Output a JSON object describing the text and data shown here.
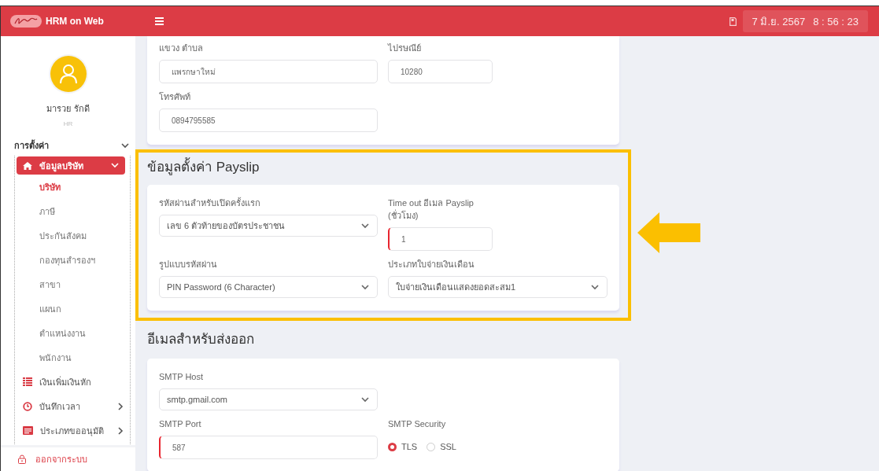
{
  "header": {
    "app_title": "HRM on Web",
    "date": "7 มิ.ย. 2567",
    "time": "8 : 56 : 23"
  },
  "user": {
    "name": "มารวย รักดี",
    "role": "HR"
  },
  "sidebar": {
    "section": "การตั้งค่า",
    "expanded": true,
    "items": [
      {
        "label": "ข้อมูลบริษัท",
        "kind": "group",
        "selected": true,
        "expanded": true,
        "children": [
          {
            "label": "บริษัท",
            "selected": true
          },
          {
            "label": "ภาษี",
            "selected": false
          },
          {
            "label": "ประกันสังคม",
            "selected": false
          },
          {
            "label": "กองทุนสำรองฯ",
            "selected": false
          },
          {
            "label": "สาขา",
            "selected": false
          },
          {
            "label": "แผนก",
            "selected": false
          },
          {
            "label": "ตำแหน่งงาน",
            "selected": false
          },
          {
            "label": "พนักงาน",
            "selected": false
          }
        ]
      },
      {
        "label": "เงินเพิ่มเงินหัก",
        "kind": "link",
        "selected": false
      },
      {
        "label": "บันทึกเวลา",
        "kind": "group",
        "selected": false,
        "expanded": false
      },
      {
        "label": "ประเภทขออนุมัติ",
        "kind": "group",
        "selected": false,
        "expanded": false
      }
    ],
    "logout": "ออกจากระบบ"
  },
  "sections": [
    {
      "highlighted": false,
      "rows": [
        [
          {
            "label": "แขวง ตำบล",
            "kind": "input",
            "value": "แพรกษาใหม่",
            "invalid": false
          },
          {
            "label": "ไปรษณีย์",
            "kind": "input",
            "value": "10280",
            "invalid": false
          }
        ],
        [
          {
            "label": "โทรศัพท์",
            "kind": "input",
            "value": "0894795585",
            "invalid": false
          }
        ]
      ]
    },
    {
      "title": "ข้อมูลตั้งค่า Payslip",
      "highlighted": true,
      "rows": [
        [
          {
            "label": "รหัสผ่านสำหรับเปิดครั้งแรก",
            "kind": "select",
            "value": "เลข 6 ตัวท้ายของบัตรประชาชน"
          },
          {
            "label": "Time out อีเมล Payslip (ชั่วโมง)",
            "kind": "input",
            "value": "1",
            "invalid": true
          }
        ],
        [
          {
            "label": "รูปแบบรหัสผ่าน",
            "kind": "select",
            "value": "PIN Password (6 Character)"
          },
          {
            "label": "ประเภทใบจ่ายเงินเดือน",
            "kind": "select",
            "value": "ใบจ่ายเงินเดือนแสดงยอดสะสม1"
          }
        ]
      ]
    },
    {
      "title": "อีเมลสำหรับส่งออก",
      "highlighted": false,
      "rows": [
        [
          {
            "label": "SMTP Host",
            "kind": "select",
            "value": "smtp.gmail.com"
          }
        ],
        [
          {
            "label": "SMTP Port",
            "kind": "input",
            "value": "587",
            "invalid": true
          },
          {
            "label": "SMTP Security",
            "kind": "radio",
            "options": [
              {
                "label": "TLS",
                "selected": true
              },
              {
                "label": "SSL",
                "selected": false
              }
            ]
          }
        ]
      ]
    }
  ]
}
